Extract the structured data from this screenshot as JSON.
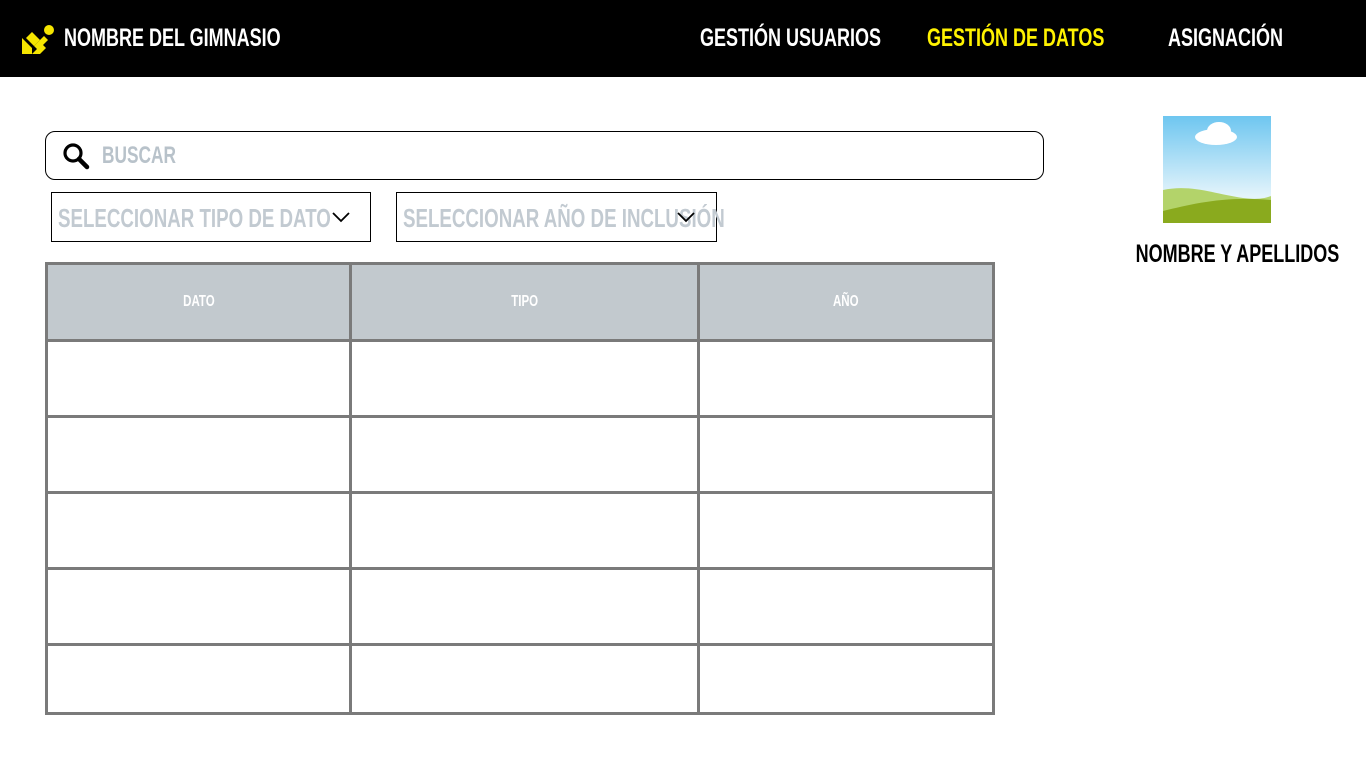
{
  "header": {
    "brand": "NOMBRE DEL GIMNASIO",
    "nav": [
      {
        "label": "GESTIÓN USUARIOS",
        "active": false
      },
      {
        "label": "GESTIÓN DE DATOS",
        "active": true
      },
      {
        "label": "ASIGNACIÓN",
        "active": false
      }
    ]
  },
  "search": {
    "placeholder": "BUSCAR"
  },
  "filters": {
    "type_label": "SELECCIONAR TIPO DE DATO",
    "year_label": "SELECCIONAR AÑO DE INCLUSIÓN"
  },
  "table": {
    "headers": [
      "DATO",
      "TIPO",
      "AÑO"
    ],
    "rows": [
      [
        "",
        "",
        ""
      ],
      [
        "",
        "",
        ""
      ],
      [
        "",
        "",
        ""
      ],
      [
        "",
        "",
        ""
      ],
      [
        "",
        "",
        ""
      ]
    ]
  },
  "profile": {
    "name": "NOMBRE Y APELLIDOS"
  },
  "colors": {
    "header_bg": "#000000",
    "active_nav": "#fff200",
    "accent_logo": "#f5e500",
    "table_header_bg": "#c2c9ce",
    "table_border": "#7a7a7a",
    "placeholder": "#c2cad1"
  },
  "icons": {
    "logo": "stripes-logo-icon",
    "search": "search-icon",
    "dropdown": "chevron-down-icon",
    "profile_image": "landscape-image-icon"
  }
}
